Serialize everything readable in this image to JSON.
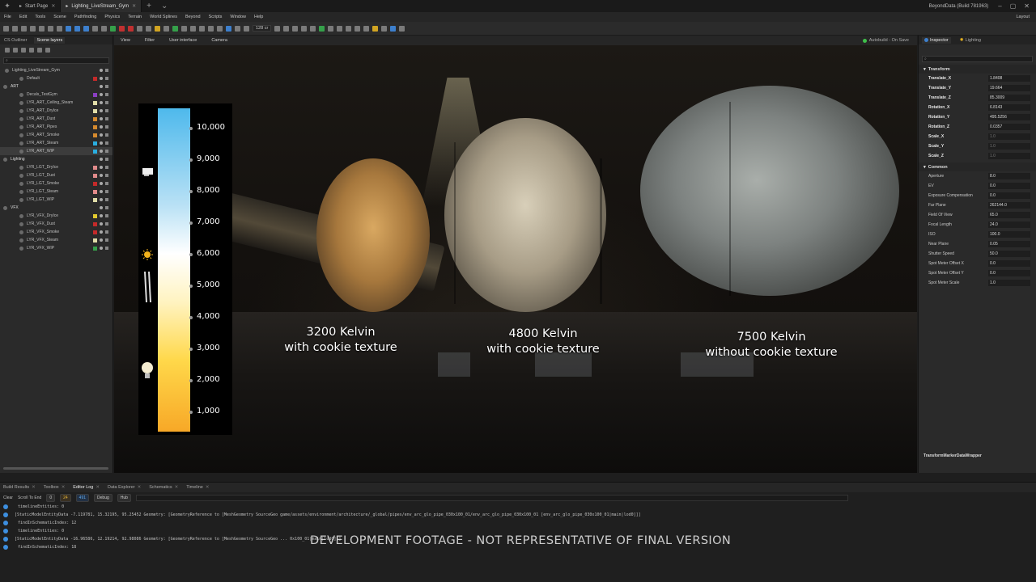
{
  "titlebar": {
    "tabs": [
      {
        "label": "Start Page"
      },
      {
        "label": "Lighting_LiveStream_Gym"
      }
    ],
    "build": "BeyondData (Build 781963)"
  },
  "menu": [
    "File",
    "Edit",
    "Tools",
    "Scene",
    "Pathfinding",
    "Physics",
    "Terrain",
    "World Splines",
    "Beyond",
    "Scripts",
    "Window",
    "Help"
  ],
  "menu_layout": "Layout",
  "toolbar": {
    "zoom": "128 cr"
  },
  "left_panel": {
    "tabs": [
      "CS Outliner",
      "Scene layers"
    ],
    "rows": [
      {
        "label": "Lighting_LiveStream_Gym",
        "type": "root"
      },
      {
        "label": "Default",
        "type": "item",
        "color": "#c42a2a"
      },
      {
        "label": "ART",
        "type": "group"
      },
      {
        "label": "Decals_TestGym",
        "type": "item",
        "color": "#8a3fc2"
      },
      {
        "label": "LYR_ART_Ceiling_Steam",
        "type": "item",
        "color": "#e0dca8"
      },
      {
        "label": "LYR_ART_DryIce",
        "type": "item",
        "color": "#e0dca8"
      },
      {
        "label": "LYR_ART_Dust",
        "type": "item",
        "color": "#d58a2e"
      },
      {
        "label": "LYR_ART_Pipes",
        "type": "item",
        "color": "#d58a2e"
      },
      {
        "label": "LYR_ART_Smoke",
        "type": "item",
        "color": "#d58a2e"
      },
      {
        "label": "LYR_ART_Steam",
        "type": "item",
        "color": "#2aaee0"
      },
      {
        "label": "LYR_ART_WIP",
        "type": "item",
        "color": "#2aaee0",
        "selected": true
      },
      {
        "label": "Lighting",
        "type": "group"
      },
      {
        "label": "LYR_LGT_DryIce",
        "type": "item",
        "color": "#e08a8a"
      },
      {
        "label": "LYR_LGT_Dust",
        "type": "item",
        "color": "#e08a8a"
      },
      {
        "label": "LYR_LGT_Smoke",
        "type": "item",
        "color": "#c42a2a"
      },
      {
        "label": "LYR_LGT_Steam",
        "type": "item",
        "color": "#e08a8a"
      },
      {
        "label": "LYR_LGT_WIP",
        "type": "item",
        "color": "#e0dca8"
      },
      {
        "label": "VFX",
        "type": "group"
      },
      {
        "label": "LYR_VFX_DryIce",
        "type": "item",
        "color": "#e0c82e"
      },
      {
        "label": "LYR_VFX_Dust",
        "type": "item",
        "color": "#c42a2a"
      },
      {
        "label": "LYR_VFX_Smoke",
        "type": "item",
        "color": "#c42a2a"
      },
      {
        "label": "LYR_VFX_Steam",
        "type": "item",
        "color": "#e0dca8"
      },
      {
        "label": "LYR_VFX_WIP",
        "type": "item",
        "color": "#35a04a"
      }
    ]
  },
  "viewport": {
    "menu": [
      "View",
      "Filter",
      "User interface",
      "Camera"
    ],
    "autobuild": "Autobuild - On Save",
    "kelvin_ticks": [
      "10,000",
      "9,000",
      "8,000",
      "7,000",
      "6,000",
      "5,000",
      "4,000",
      "3,000",
      "2,000",
      "1,000"
    ],
    "labels": [
      {
        "line1": "3200 Kelvin",
        "line2": "with cookie texture"
      },
      {
        "line1": "4800 Kelvin",
        "line2": "with cookie texture"
      },
      {
        "line1": "7500 Kelvin",
        "line2": "without cookie texture"
      }
    ]
  },
  "inspector": {
    "tabs": [
      "Inspector",
      "Lighting"
    ],
    "sections": [
      {
        "title": "Transform",
        "props": [
          {
            "label": "Translate_X",
            "value": "1.8408",
            "bold": true
          },
          {
            "label": "Translate_Y",
            "value": "19.664",
            "bold": true
          },
          {
            "label": "Translate_Z",
            "value": "85.3009",
            "bold": true
          },
          {
            "label": "Rotation_X",
            "value": "6.8143",
            "bold": true
          },
          {
            "label": "Rotation_Y",
            "value": "495.5256",
            "bold": true
          },
          {
            "label": "Rotation_Z",
            "value": "0.0357",
            "bold": true
          },
          {
            "label": "Scale_X",
            "value": "1.0",
            "bold": true,
            "dim": true
          },
          {
            "label": "Scale_Y",
            "value": "1.0",
            "bold": true,
            "dim": true
          },
          {
            "label": "Scale_Z",
            "value": "1.0",
            "bold": true,
            "dim": true
          }
        ]
      },
      {
        "title": "Common",
        "props": [
          {
            "label": "Aperture",
            "value": "8.0"
          },
          {
            "label": "EV",
            "value": "0.0"
          },
          {
            "label": "Exposure Compensation",
            "value": "0.0"
          },
          {
            "label": "Far Plane",
            "value": "262144.0"
          },
          {
            "label": "Field Of View",
            "value": "65.0"
          },
          {
            "label": "Focal Length",
            "value": "24.0"
          },
          {
            "label": "ISO",
            "value": "100.0"
          },
          {
            "label": "Near Plane",
            "value": "0.05"
          },
          {
            "label": "Shutter Speed",
            "value": "50.0"
          },
          {
            "label": "Spot Meter Offset X",
            "value": "0.0"
          },
          {
            "label": "Spot Meter Offset Y",
            "value": "0.0"
          },
          {
            "label": "Spot Meter Scale",
            "value": "1.0"
          }
        ]
      }
    ],
    "footer": "TransformMarkerDataWrapper"
  },
  "bottom": {
    "tabs": [
      "Build Results",
      "Toolbox",
      "Editor Log",
      "Data Explorer",
      "Schematics",
      "Timeline"
    ],
    "filters": {
      "clear": "Clear",
      "scroll": "Scroll To End",
      "errors": "0",
      "warnings": "24",
      "info": "491",
      "debug": "Debug",
      "hub": "Hub"
    },
    "log": [
      "timelineEntities: 0",
      "[StaticModelEntityData -7.119781, 15.32195, 95.25452 Geometry: [GeometryReference to [MeshGeometry SourceGeo game/assets/environment/architecture/_global/pipes/env_arc_glo_pipe_030x100_01/env_arc_glo_pipe_030x100_01 [env_arc_glo_pipe_030x100_01|main|lod0]]]",
      "findInSchematicIndex: 12",
      "timelineEntities: 0",
      "[StaticModelEntityData -16.96586, 12.19214, 92.98086 Geometry: [GeometryReference to [MeshGeometry SourceGeo ... 0x100_01|main|lod0]]]",
      "findInSchematicIndex: 18"
    ]
  },
  "watermark": "DEVELOPMENT FOOTAGE - NOT REPRESENTATIVE OF FINAL VERSION"
}
